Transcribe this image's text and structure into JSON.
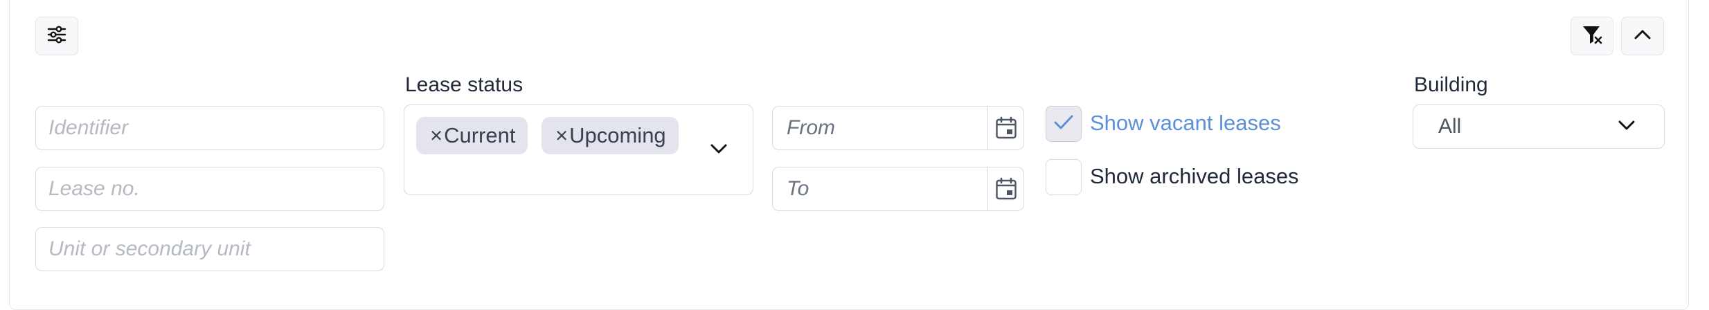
{
  "filters": {
    "identifier": {
      "placeholder": "Identifier"
    },
    "lease_no": {
      "placeholder": "Lease no."
    },
    "unit": {
      "placeholder": "Unit or secondary unit"
    }
  },
  "lease_status": {
    "label": "Lease status",
    "chips": [
      {
        "remove_glyph": "×",
        "label": "Current"
      },
      {
        "remove_glyph": "×",
        "label": "Upcoming"
      }
    ]
  },
  "dates": {
    "from_placeholder": "From",
    "to_placeholder": "To"
  },
  "options": {
    "show_vacant": {
      "label": "Show vacant leases",
      "checked": true
    },
    "show_archived": {
      "label": "Show archived leases",
      "checked": false
    }
  },
  "building": {
    "label": "Building",
    "selected": "All"
  },
  "icons": {
    "settings": "sliders-icon",
    "clear_filters": "filter-clear-icon",
    "collapse": "chevron-up-icon",
    "calendar": "calendar-icon",
    "check": "check-icon",
    "dropdown": "chevron-down-icon"
  },
  "colors": {
    "accent": "#5b8fd9",
    "chip_bg": "#e3e4ec",
    "border": "#d7dae0",
    "placeholder": "#b4b9c2"
  }
}
